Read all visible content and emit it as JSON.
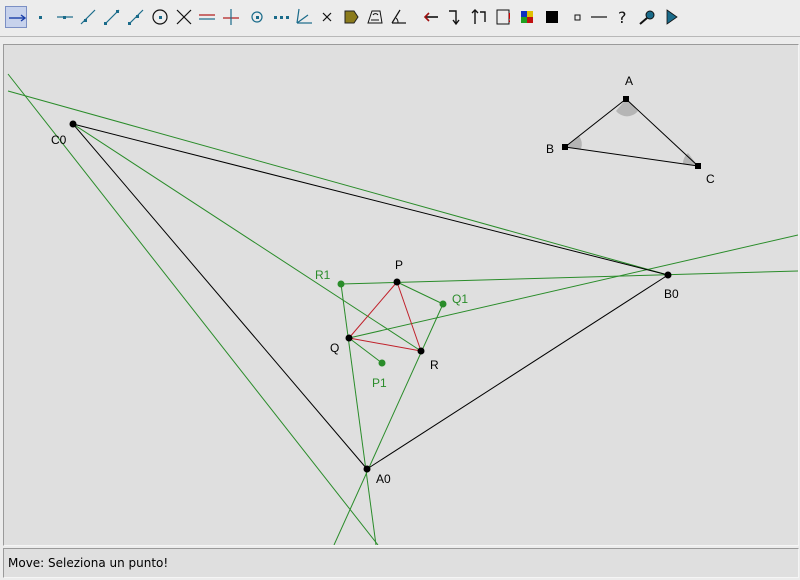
{
  "toolbar": {
    "tools": [
      {
        "icon": "move-arrow-icon",
        "active": true
      },
      {
        "icon": "point-icon"
      },
      {
        "icon": "line-icon"
      },
      {
        "icon": "segment-icon"
      },
      {
        "icon": "ray-icon"
      },
      {
        "icon": "vector-icon"
      },
      {
        "icon": "circle-icon"
      },
      {
        "icon": "intersection-icon"
      },
      {
        "icon": "parallel-line-icon"
      },
      {
        "icon": "perpendicular-line-icon"
      },
      {
        "icon": "midpoint-icon"
      },
      {
        "icon": "dotted-line-icon"
      },
      {
        "icon": "angle-bisector-icon"
      },
      {
        "icon": "delete-x-icon"
      },
      {
        "icon": "fill-polygon-icon"
      },
      {
        "icon": "measure-length-icon"
      },
      {
        "icon": "measure-angle-icon"
      },
      {
        "icon": "undo-arrow-icon"
      },
      {
        "icon": "redo-arrow-icon"
      },
      {
        "icon": "animate-icon"
      },
      {
        "icon": "trace-icon"
      },
      {
        "icon": "color-palette-icon"
      },
      {
        "icon": "filled-square-icon"
      },
      {
        "icon": "hollow-square-icon"
      },
      {
        "icon": "thin-line-icon"
      },
      {
        "icon": "help-icon"
      },
      {
        "icon": "magnifier-icon"
      },
      {
        "icon": "play-icon"
      }
    ]
  },
  "figure": {
    "labels": {
      "A": "A",
      "B": "B",
      "C": "C",
      "A0": "A0",
      "B0": "B0",
      "C0": "C0",
      "P": "P",
      "Q": "Q",
      "R": "R",
      "P1": "P1",
      "Q1": "Q1",
      "R1": "R1"
    }
  },
  "status": {
    "text": "Move: Seleziona un punto!"
  },
  "colors": {
    "green": "#2a8c2a",
    "red": "#c0202a",
    "black": "#000000",
    "canvas": "#dfdfdf"
  }
}
